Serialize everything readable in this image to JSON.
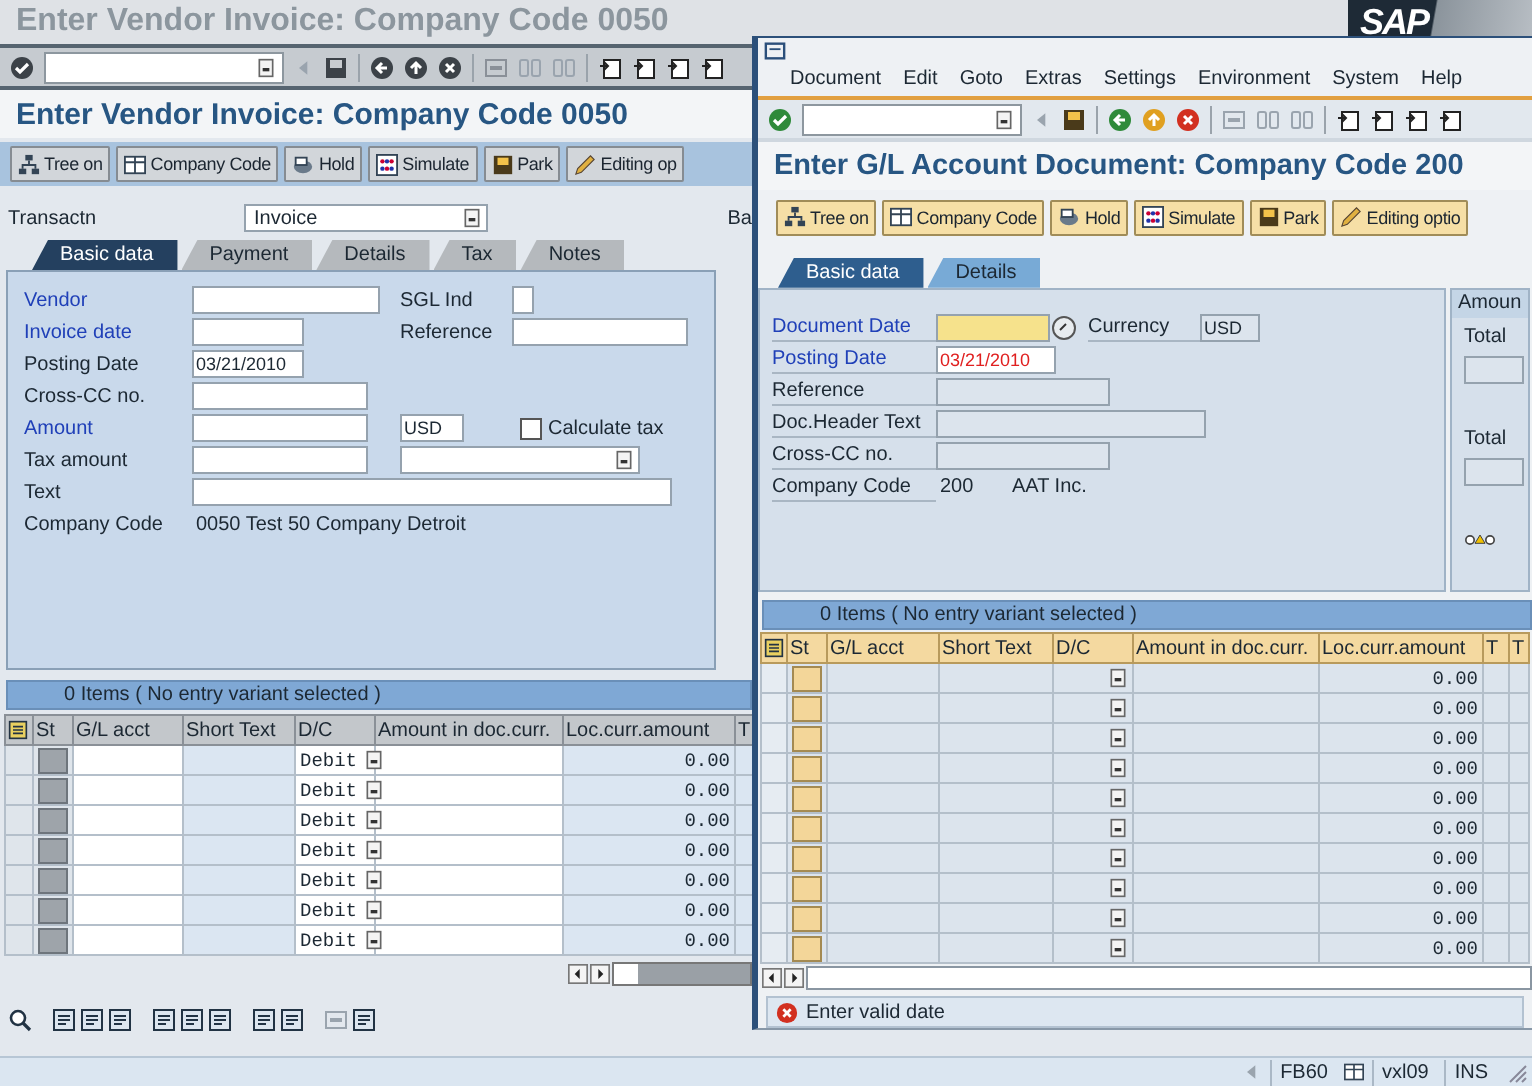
{
  "back_window": {
    "title": "Enter Vendor Invoice: Company Code 0050",
    "logo": "SAP",
    "screen_title": "Enter Vendor Invoice: Company Code 0050",
    "app_buttons": [
      {
        "kind": "tree",
        "label": "Tree on"
      },
      {
        "kind": "company",
        "label": "Company Code"
      },
      {
        "kind": "hold",
        "label": "Hold"
      },
      {
        "kind": "simulate",
        "label": "Simulate"
      },
      {
        "kind": "park",
        "label": "Park"
      },
      {
        "kind": "pencil",
        "label": "Editing op"
      }
    ],
    "transaction": {
      "label": "Transactn",
      "value": "Invoice"
    },
    "cut_label": "Ba",
    "tabs": [
      {
        "label": "Basic data",
        "selected": true
      },
      {
        "label": "Payment",
        "selected": false
      },
      {
        "label": "Details",
        "selected": false
      },
      {
        "label": "Tax",
        "selected": false
      },
      {
        "label": "Notes",
        "selected": false
      }
    ],
    "form": {
      "rows": [
        {
          "label": "Vendor",
          "required": true,
          "field": {
            "kind": "input"
          },
          "side": {
            "kind": "labeled",
            "label": "SGL Ind"
          }
        },
        {
          "label": "Invoice date",
          "required": true,
          "field": {
            "kind": "input"
          },
          "side": {
            "kind": "labeled",
            "label": "Reference"
          }
        },
        {
          "label": "Posting Date",
          "required": false,
          "field": {
            "kind": "input",
            "value": "03/21/2010"
          }
        },
        {
          "label": "Cross-CC no.",
          "required": false,
          "field": {
            "kind": "input"
          }
        },
        {
          "label": "Amount",
          "required": true,
          "field": {
            "kind": "input"
          },
          "side": {
            "kind": "currency",
            "value": "USD"
          },
          "check": {
            "label": "Calculate tax",
            "checked": false
          }
        },
        {
          "label": "Tax amount",
          "required": false,
          "field": {
            "kind": "input"
          },
          "side": {
            "kind": "dropdown"
          }
        },
        {
          "label": "Text",
          "required": false,
          "field": {
            "kind": "input"
          }
        },
        {
          "label": "Company Code",
          "required": false,
          "field": {
            "kind": "display",
            "value": "0050 Test 50 Company Detroit"
          }
        }
      ]
    },
    "items_title": "0 Items ( No entry variant selected )",
    "columns": [
      "St",
      "G/L acct",
      "Short Text",
      "D/C",
      "Amount in doc.curr.",
      "Loc.curr.amount",
      "T"
    ],
    "rows": [
      {
        "dc": "Debit",
        "loc_amount": "0.00"
      },
      {
        "dc": "Debit",
        "loc_amount": "0.00"
      },
      {
        "dc": "Debit",
        "loc_amount": "0.00"
      },
      {
        "dc": "Debit",
        "loc_amount": "0.00"
      },
      {
        "dc": "Debit",
        "loc_amount": "0.00"
      },
      {
        "dc": "Debit",
        "loc_amount": "0.00"
      },
      {
        "dc": "Debit",
        "loc_amount": "0.00"
      }
    ],
    "status_bar": [
      "FB60",
      "vxl09",
      "INS"
    ]
  },
  "front_window": {
    "menu": [
      "Document",
      "Edit",
      "Goto",
      "Extras",
      "Settings",
      "Environment",
      "System",
      "Help"
    ],
    "screen_title": "Enter G/L Account Document: Company Code 200",
    "app_buttons": [
      {
        "kind": "tree",
        "label": "Tree on"
      },
      {
        "kind": "company",
        "label": "Company Code"
      },
      {
        "kind": "hold",
        "label": "Hold"
      },
      {
        "kind": "simulate",
        "label": "Simulate"
      },
      {
        "kind": "park",
        "label": "Park"
      },
      {
        "kind": "pencil",
        "label": "Editing optio"
      }
    ],
    "tabs": [
      {
        "label": "Basic data",
        "selected": true
      },
      {
        "label": "Details",
        "selected": false
      }
    ],
    "form": {
      "rows": [
        {
          "label": "Document Date",
          "required": true,
          "field": {
            "kind": "input",
            "focused": true
          },
          "side": {
            "label": "Currency",
            "value": "USD"
          }
        },
        {
          "label": "Posting Date",
          "required": true,
          "field": {
            "kind": "input",
            "value": "03/21/2010",
            "error": true
          }
        },
        {
          "label": "Reference",
          "required": false,
          "field": {
            "kind": "input"
          }
        },
        {
          "label": "Doc.Header Text",
          "required": false,
          "field": {
            "kind": "input"
          }
        },
        {
          "label": "Cross-CC no.",
          "required": false,
          "field": {
            "kind": "input"
          }
        },
        {
          "label": "Company Code",
          "required": false,
          "field": {
            "kind": "display",
            "value": "200",
            "name": "AAT Inc."
          }
        }
      ]
    },
    "amount_panel": {
      "title": "Amoun",
      "labels": [
        "Total",
        "Total"
      ]
    },
    "items_title": "0 Items ( No entry variant selected )",
    "columns": [
      "St",
      "G/L acct",
      "Short Text",
      "D/C",
      "Amount in doc.curr.",
      "Loc.curr.amount",
      "T",
      "T"
    ],
    "rows": [
      {
        "loc_amount": "0.00"
      },
      {
        "loc_amount": "0.00"
      },
      {
        "loc_amount": "0.00"
      },
      {
        "loc_amount": "0.00"
      },
      {
        "loc_amount": "0.00"
      },
      {
        "loc_amount": "0.00"
      },
      {
        "loc_amount": "0.00"
      },
      {
        "loc_amount": "0.00"
      },
      {
        "loc_amount": "0.00"
      },
      {
        "loc_amount": "0.00"
      }
    ],
    "message": {
      "kind": "error",
      "text": "Enter valid date"
    }
  }
}
